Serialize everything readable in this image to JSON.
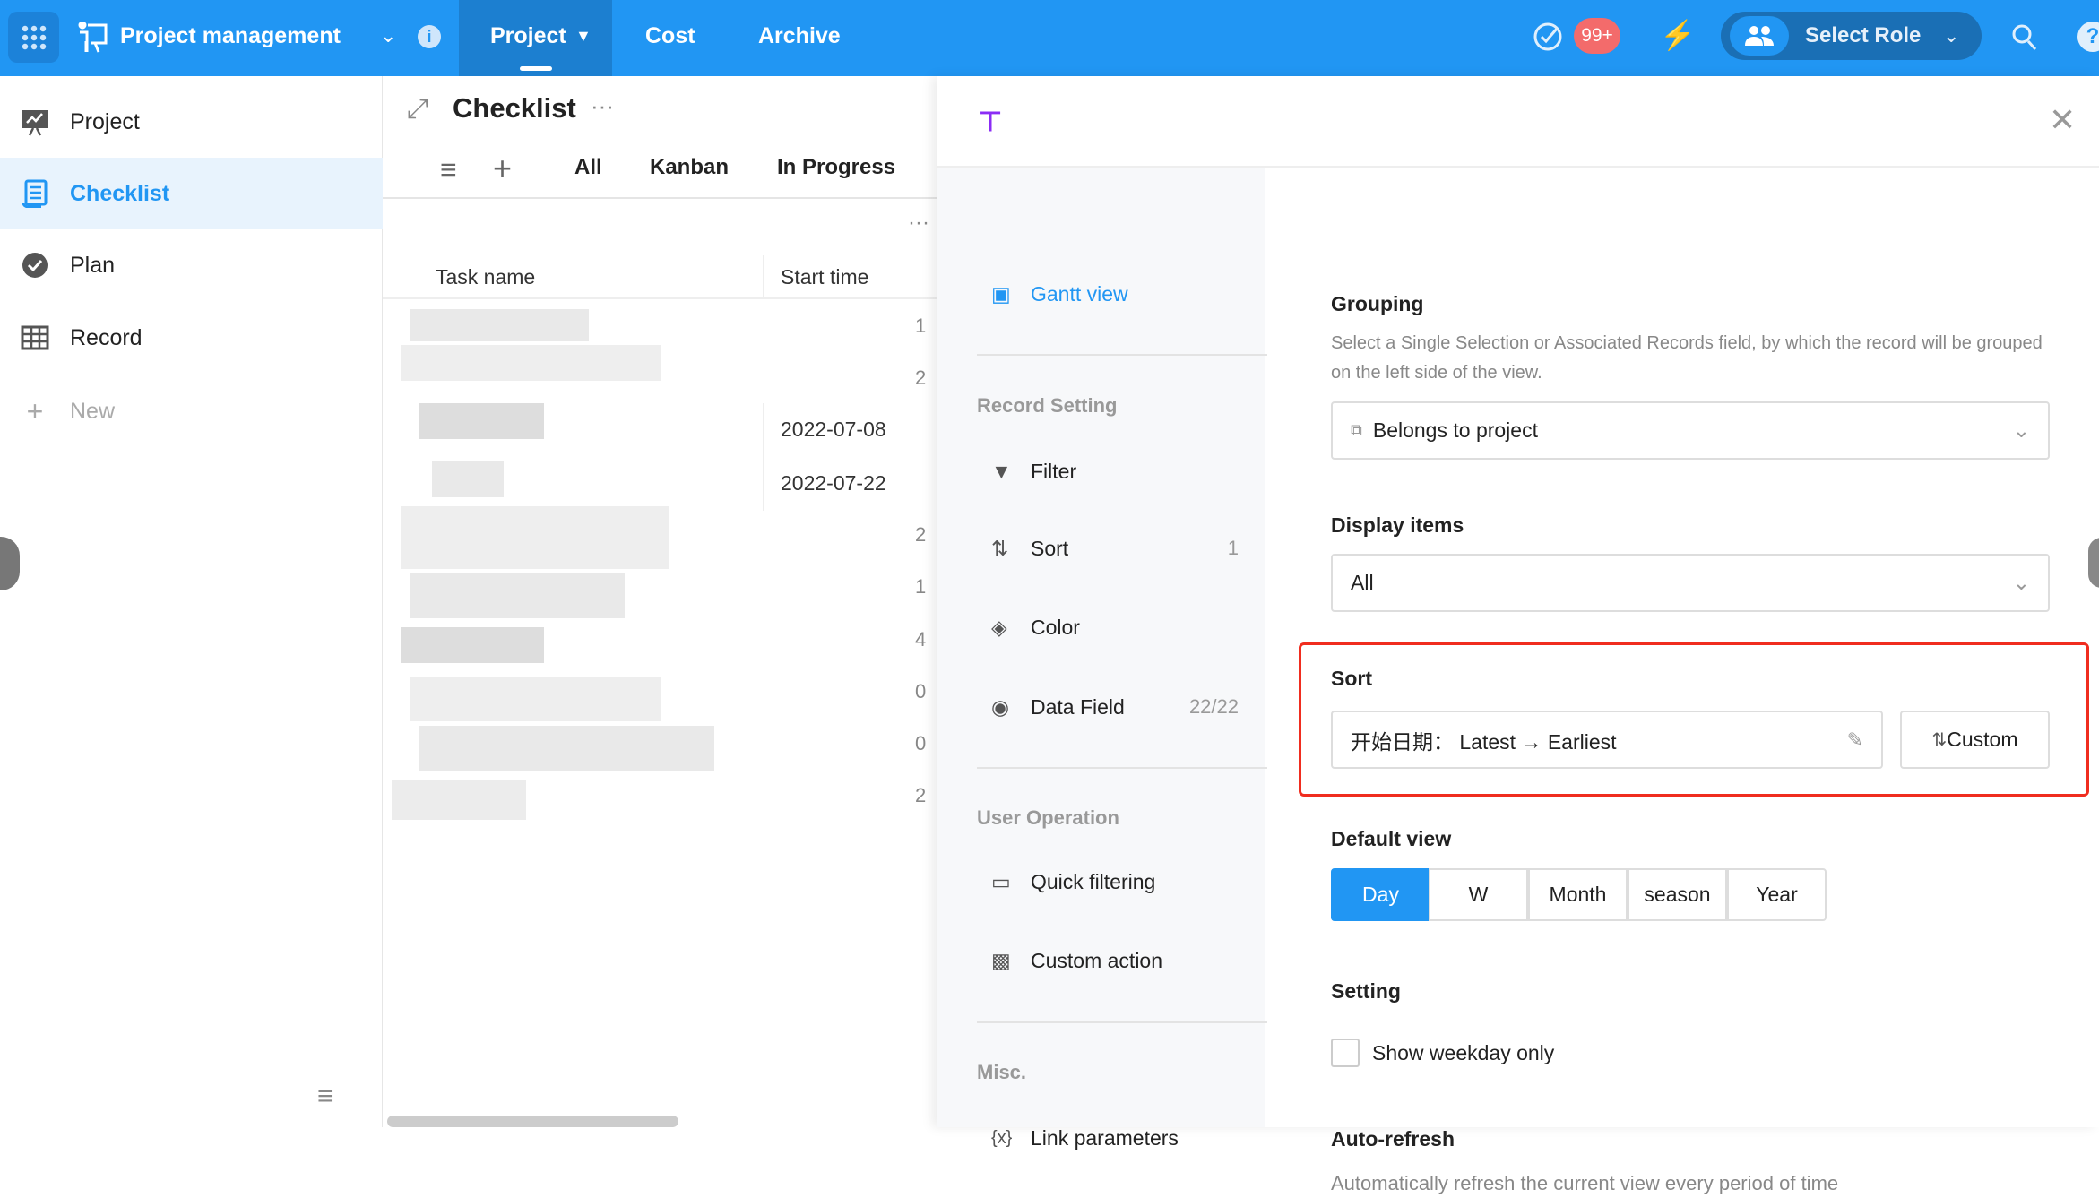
{
  "topbar": {
    "app_title": "Project management",
    "tabs": [
      {
        "label": "Project",
        "active": true
      },
      {
        "label": "Cost"
      },
      {
        "label": "Archive"
      }
    ],
    "badge": "99+",
    "role_label": "Select Role",
    "accent": "#2196f3"
  },
  "sidebar": {
    "items": [
      {
        "label": "Project",
        "icon": "presentation-chart-icon"
      },
      {
        "label": "Checklist",
        "icon": "list-doc-icon",
        "active": true
      },
      {
        "label": "Plan",
        "icon": "badge-check-icon"
      },
      {
        "label": "Record",
        "icon": "table-icon"
      }
    ],
    "new_label": "New"
  },
  "main": {
    "title": "Checklist",
    "views": [
      "All",
      "Kanban",
      "In Progress"
    ],
    "columns": [
      "Task name",
      "Start time"
    ],
    "dates": [
      "2022-07-08",
      "2022-07-22"
    ],
    "counts": [
      "1",
      "2",
      "2",
      "1",
      "4",
      "0",
      "0",
      "2"
    ]
  },
  "panel": {
    "nav": {
      "gantt": "Gantt view",
      "record_setting": "Record Setting",
      "filter": "Filter",
      "sort": "Sort",
      "sort_count": "1",
      "color": "Color",
      "data_field": "Data Field",
      "data_field_count": "22/22",
      "user_operation": "User Operation",
      "quick_filtering": "Quick filtering",
      "custom_action": "Custom action",
      "misc": "Misc.",
      "link_parameters": "Link parameters"
    },
    "grouping": {
      "title": "Grouping",
      "desc": "Select a Single Selection or Associated Records field, by which the record will be grouped on the left side of the view.",
      "value": "Belongs to project"
    },
    "display": {
      "title": "Display items",
      "value": "All"
    },
    "sort": {
      "title": "Sort",
      "value": "开始日期： Latest → Earliest",
      "custom": "Custom"
    },
    "default_view": {
      "title": "Default view",
      "options": [
        "Day",
        "W",
        "Month",
        "season",
        "Year"
      ],
      "selected": "Day"
    },
    "setting": {
      "title": "Setting",
      "weekday_only": "Show weekday only",
      "checked": false
    },
    "autorefresh": {
      "title": "Auto-refresh",
      "desc": "Automatically refresh the current view every period of time"
    }
  }
}
